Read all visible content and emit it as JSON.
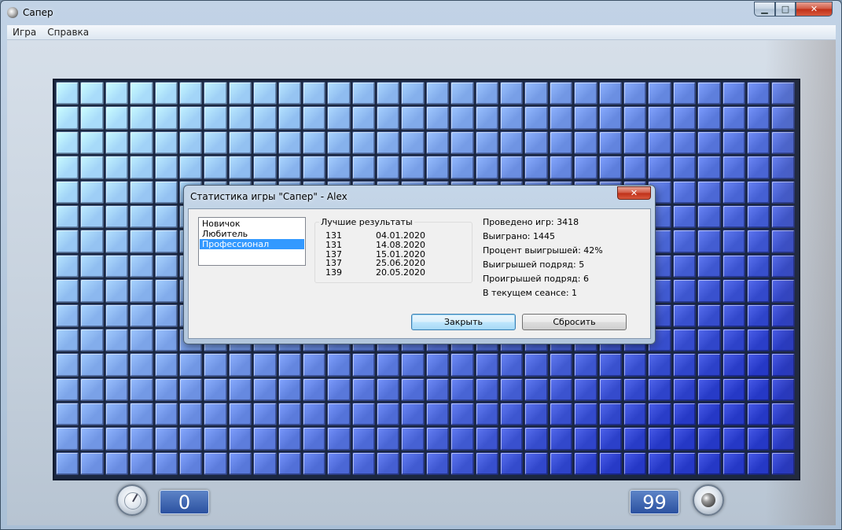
{
  "window": {
    "title": "Сапер",
    "controls": {
      "minimize": "▁",
      "maximize": "□",
      "close": "✕"
    }
  },
  "menu": [
    "Игра",
    "Справка"
  ],
  "field": {
    "cols": 30,
    "rows": 16,
    "top_color": "#a9dcfa",
    "bottom_color": "#2538c6"
  },
  "counters": {
    "timer": "0",
    "mines": "99"
  },
  "icons": {
    "timer": "clock-icon",
    "mines": "mine-icon"
  },
  "stats_dialog": {
    "title": "Статистика игры \"Сапер\" - Alex",
    "close_glyph": "✕",
    "levels": [
      "Новичок",
      "Любитель",
      "Профессионал"
    ],
    "selected_level": "Профессионал",
    "best_title": "Лучшие результаты",
    "best": [
      {
        "time": "131",
        "date": "04.01.2020"
      },
      {
        "time": "131",
        "date": "14.08.2020"
      },
      {
        "time": "137",
        "date": "15.01.2020"
      },
      {
        "time": "137",
        "date": "25.06.2020"
      },
      {
        "time": "139",
        "date": "20.05.2020"
      }
    ],
    "stats": [
      "Проведено игр: 3418",
      "Выиграно: 1445",
      "Процент выигрышей: 42%",
      "Выигрышей подряд: 5",
      "Проигрышей подряд: 6",
      "В текущем сеансе: 1"
    ],
    "buttons": {
      "close": "Закрыть",
      "reset": "Сбросить"
    }
  }
}
